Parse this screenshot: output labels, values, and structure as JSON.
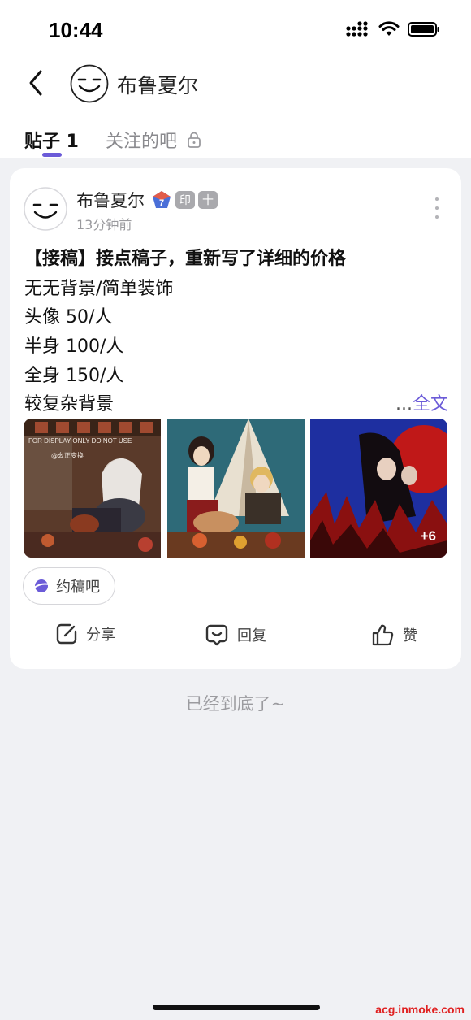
{
  "status_bar": {
    "time": "10:44"
  },
  "header": {
    "name": "布鲁夏尔"
  },
  "tabs": [
    {
      "label": "贴子 1"
    },
    {
      "label": "关注的吧"
    }
  ],
  "post": {
    "author": "布鲁夏尔",
    "level_badge": "7",
    "badges": [
      "印",
      "十"
    ],
    "time": "13分钟前",
    "title": "【接稿】接点稿子，重新写了详细的价格",
    "lines": [
      "无无背景/简单装饰",
      "头像 50/人",
      "半身 100/人",
      "全身 150/人",
      "较复杂背景"
    ],
    "read_more_ellipsis": "...",
    "read_more": "全文",
    "image_watermark_1": "FOR DISPLAY ONLY DO NOT USE",
    "image_watermark_1b": "@幺正变换",
    "extra_images": "+6",
    "forum": "约稿吧",
    "actions": {
      "share": "分享",
      "reply": "回复",
      "like": "赞"
    }
  },
  "footer": {
    "end_text": "已经到底了~"
  },
  "site_watermark": "acg.inmoke.com",
  "colors": {
    "accent": "#6b5bd8",
    "background": "#f0f1f4",
    "card": "#ffffff"
  }
}
